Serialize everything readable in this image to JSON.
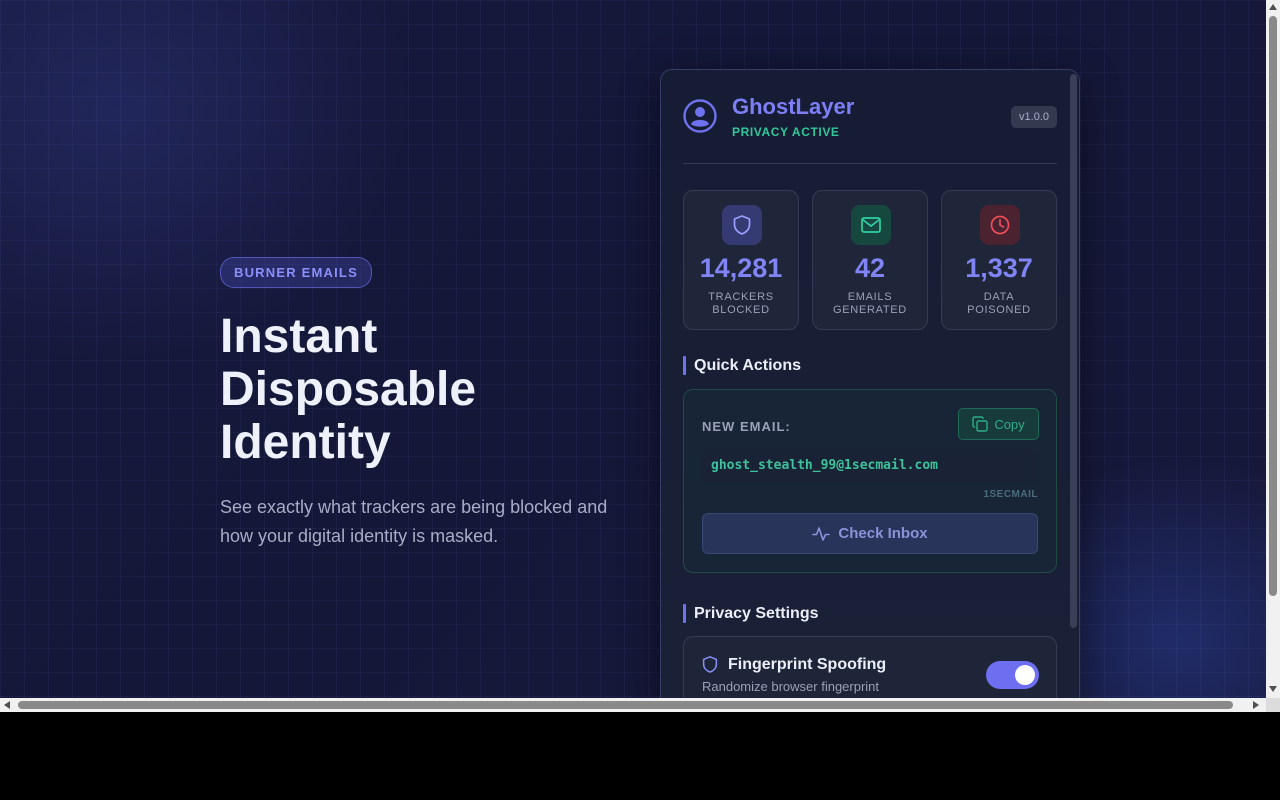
{
  "hero": {
    "badge": "BURNER EMAILS",
    "title": "Instant\nDisposable\nIdentity",
    "subtitle": "See exactly what trackers are being blocked and how your digital identity is masked."
  },
  "panel": {
    "title": "GhostLayer",
    "status": "PRIVACY ACTIVE",
    "version": "v1.0.0",
    "stats": [
      {
        "value": "14,281",
        "label": "TRACKERS\nBLOCKED",
        "icon": "shield-icon"
      },
      {
        "value": "42",
        "label": "EMAILS\nGENERATED",
        "icon": "mail-icon"
      },
      {
        "value": "1,337",
        "label": "DATA\nPOISONED",
        "icon": "clock-icon"
      }
    ],
    "quick_actions": {
      "title": "Quick Actions",
      "new_email_label": "NEW EMAIL:",
      "copy_label": "Copy",
      "email": "ghost_stealth_99@1secmail.com",
      "provider": "1SECMAIL",
      "check_inbox_label": "Check Inbox"
    },
    "privacy": {
      "title": "Privacy Settings",
      "settings": [
        {
          "name": "Fingerprint Spoofing",
          "description": "Randomize browser fingerprint",
          "enabled": true
        }
      ]
    }
  },
  "colors": {
    "accent": "#7c7ff5",
    "success": "#2fc89a",
    "danger": "#e0474f"
  }
}
